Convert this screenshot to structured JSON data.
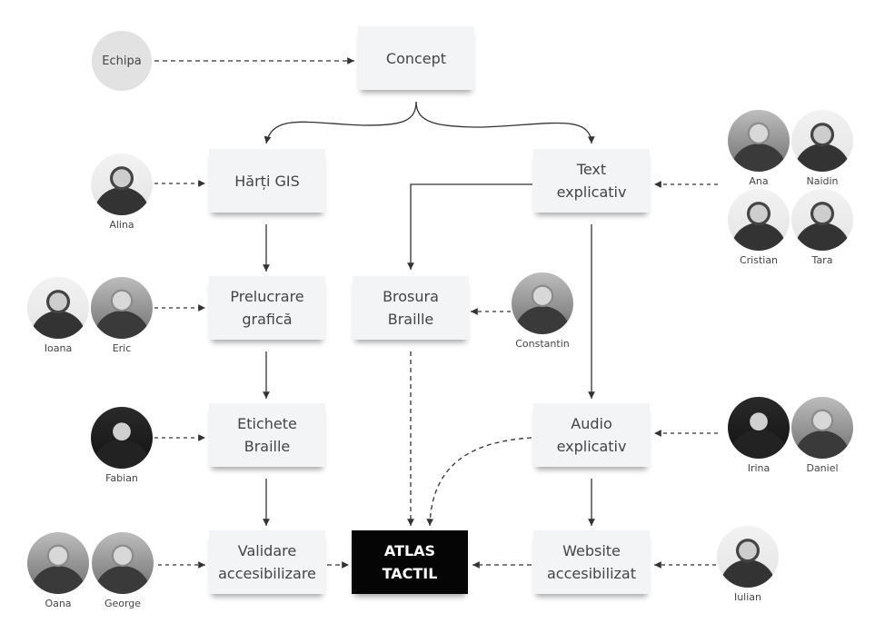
{
  "diagram": {
    "start": {
      "label": "Echipa"
    },
    "nodes": {
      "concept": {
        "lines": [
          "Concept"
        ]
      },
      "harti_gis": {
        "lines": [
          "Hărți GIS"
        ]
      },
      "text_explicativ": {
        "lines": [
          "Text",
          "explicativ"
        ]
      },
      "prelucrare_grafica": {
        "lines": [
          "Prelucrare",
          "grafică"
        ]
      },
      "brosura_braille": {
        "lines": [
          "Brosura",
          "Braille"
        ]
      },
      "etichete_braille": {
        "lines": [
          "Etichete",
          "Braille"
        ]
      },
      "audio_explicativ": {
        "lines": [
          "Audio",
          "explicativ"
        ]
      },
      "validare": {
        "lines": [
          "Validare",
          "accesibilizare"
        ]
      },
      "atlas_tactil": {
        "lines": [
          "ATLAS",
          "TACTIL"
        ]
      },
      "website": {
        "lines": [
          "Website",
          "accesibilizat"
        ]
      }
    },
    "people": {
      "alina": "Alina",
      "ioana": "Ioana",
      "eric": "Eric",
      "fabian": "Fabian",
      "oana": "Oana",
      "george": "George",
      "ana": "Ana",
      "naidin": "Naidin",
      "cristian": "Cristian",
      "tara": "Tara",
      "constantin": "Constantin",
      "irina": "Irina",
      "daniel": "Daniel",
      "iulian": "Iulian"
    },
    "colors": {
      "node_bg": "#f3f4f5",
      "final_node_bg": "#050505",
      "final_node_text": "#ffffff",
      "start_circle": "#e2e2e2",
      "line": "#333333"
    }
  }
}
